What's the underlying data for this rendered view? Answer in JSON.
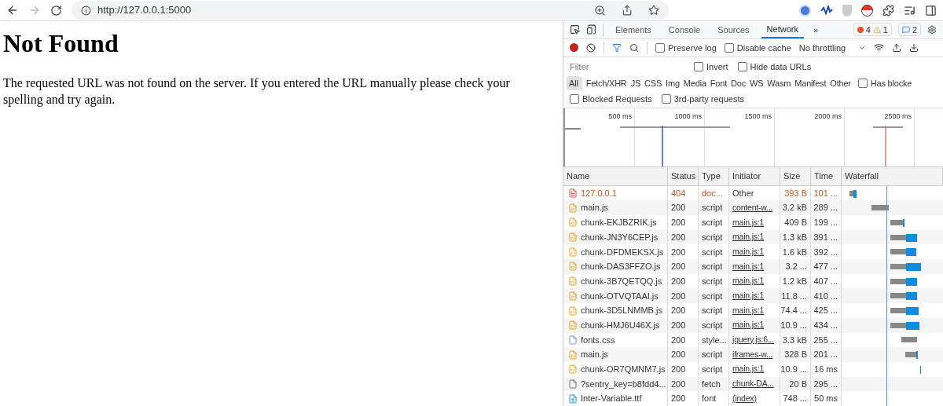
{
  "browser": {
    "url": "http://127.0.0.1:5000"
  },
  "page": {
    "heading": "Not Found",
    "message": "The requested URL was not found on the server. If you entered the URL manually please check your spelling and try again."
  },
  "devtools": {
    "tabs": [
      {
        "label": "Elements",
        "selected": false
      },
      {
        "label": "Console",
        "selected": false
      },
      {
        "label": "Sources",
        "selected": false
      },
      {
        "label": "Network",
        "selected": true
      }
    ],
    "more_tabs": "»",
    "errors": "4",
    "warnings": "1",
    "messages": "2",
    "toolbar": {
      "recording": true,
      "preserve_log": {
        "label": "Preserve log",
        "checked": false
      },
      "disable_cache": {
        "label": "Disable cache",
        "checked": false
      },
      "throttling": "No throttling"
    },
    "filter": {
      "placeholder": "Filter",
      "invert": {
        "label": "Invert",
        "checked": false
      },
      "hide_data_urls": {
        "label": "Hide data URLs",
        "checked": false
      }
    },
    "type_filters": [
      {
        "label": "All",
        "selected": true
      },
      {
        "label": "Fetch/XHR",
        "selected": false
      },
      {
        "label": "JS",
        "selected": false
      },
      {
        "label": "CSS",
        "selected": false
      },
      {
        "label": "Img",
        "selected": false
      },
      {
        "label": "Media",
        "selected": false
      },
      {
        "label": "Font",
        "selected": false
      },
      {
        "label": "Doc",
        "selected": false
      },
      {
        "label": "WS",
        "selected": false
      },
      {
        "label": "Wasm",
        "selected": false
      },
      {
        "label": "Manifest",
        "selected": false
      },
      {
        "label": "Other",
        "selected": false
      }
    ],
    "has_blocked": {
      "label": "Has blocke",
      "checked": false
    },
    "blocked_requests": {
      "label": "Blocked Requests",
      "checked": false
    },
    "third_party": {
      "label": "3rd-party requests",
      "checked": false
    },
    "overview_ticks": [
      "500 ms",
      "1000 ms",
      "1500 ms",
      "2000 ms",
      "2500 ms"
    ],
    "columns": [
      "Name",
      "Status",
      "Type",
      "Initiator",
      "Size",
      "Time",
      "Waterfall"
    ],
    "rows": [
      {
        "kind": "doc",
        "error": true,
        "name": "127.0.0.1",
        "status": "404",
        "type": "doc...",
        "initiator": "Other",
        "size": "393 B",
        "time": "101 ..."
      },
      {
        "kind": "script",
        "error": false,
        "name": "main.js",
        "status": "200",
        "type": "script",
        "initiator": "content-w...",
        "size": "3.2 kB",
        "time": "289 ..."
      },
      {
        "kind": "script",
        "error": false,
        "name": "chunk-EKJBZRIK.js",
        "status": "200",
        "type": "script",
        "initiator": "main.js:1",
        "size": "409 B",
        "time": "199 ..."
      },
      {
        "kind": "script",
        "error": false,
        "name": "chunk-JN3Y6CEP.js",
        "status": "200",
        "type": "script",
        "initiator": "main.js:1",
        "size": "1.3 kB",
        "time": "391 ..."
      },
      {
        "kind": "script",
        "error": false,
        "name": "chunk-DFDMEKSX.js",
        "status": "200",
        "type": "script",
        "initiator": "main.js:1",
        "size": "1.6 kB",
        "time": "392 ..."
      },
      {
        "kind": "script",
        "error": false,
        "name": "chunk-DAS3FFZO.js",
        "status": "200",
        "type": "script",
        "initiator": "main.js:1",
        "size": "3.2 ...",
        "time": "477 ..."
      },
      {
        "kind": "script",
        "error": false,
        "name": "chunk-3B7QETQQ.js",
        "status": "200",
        "type": "script",
        "initiator": "main.js:1",
        "size": "1.2 kB",
        "time": "407 ..."
      },
      {
        "kind": "script",
        "error": false,
        "name": "chunk-OTVQTAAI.js",
        "status": "200",
        "type": "script",
        "initiator": "main.js:1",
        "size": "11.8 ...",
        "time": "410 ..."
      },
      {
        "kind": "script",
        "error": false,
        "name": "chunk-3D5LNMMB.js",
        "status": "200",
        "type": "script",
        "initiator": "main.js:1",
        "size": "74.4 ...",
        "time": "425 ..."
      },
      {
        "kind": "script",
        "error": false,
        "name": "chunk-HMJ6U46X.js",
        "status": "200",
        "type": "script",
        "initiator": "main.js:1",
        "size": "10.9 ...",
        "time": "434 ..."
      },
      {
        "kind": "css",
        "error": false,
        "name": "fonts.css",
        "status": "200",
        "type": "style...",
        "initiator": "jquery.js:6...",
        "size": "3.3 kB",
        "time": "255 ..."
      },
      {
        "kind": "script",
        "error": false,
        "name": "main.js",
        "status": "200",
        "type": "script",
        "initiator": "iframes-w...",
        "size": "328 B",
        "time": "201 ..."
      },
      {
        "kind": "script",
        "error": false,
        "name": "chunk-OR7QMNM7.js",
        "status": "200",
        "type": "script",
        "initiator": "main.js:1",
        "size": "10.9 ...",
        "time": "16 ms"
      },
      {
        "kind": "fetch",
        "error": false,
        "name": "?sentry_key=b8fdd4...",
        "status": "200",
        "type": "fetch",
        "initiator": "chunk-DA...",
        "size": "20 B",
        "time": "295 ..."
      },
      {
        "kind": "font",
        "error": false,
        "name": "Inter-Variable.ttf",
        "status": "200",
        "type": "font",
        "initiator": "(index)",
        "size": "748 ...",
        "time": "50 ms"
      }
    ]
  }
}
